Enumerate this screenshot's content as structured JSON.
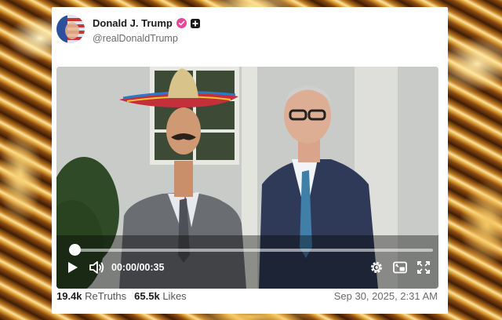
{
  "post": {
    "display_name": "Donald J. Trump",
    "handle": "@realDonaldTrump",
    "verified_icon": "verified-badge-icon",
    "badge_icon": "plus-badge-icon"
  },
  "video": {
    "current_time": "00:00",
    "duration": "00:35",
    "time_display": "00:00/00:35",
    "progress_fraction": 0,
    "icons": [
      "play-icon",
      "volume-icon",
      "settings-icon",
      "picture-in-picture-icon",
      "fullscreen-icon"
    ]
  },
  "stats": {
    "retruths_count": "19.4k",
    "retruths_label": "ReTruths",
    "likes_count": "65.5k",
    "likes_label": "Likes"
  },
  "timestamp": "Sep 30, 2025, 2:31 AM",
  "colors": {
    "verified": "#e5489a",
    "card": "#ffffff",
    "text": "#1b1b1b"
  }
}
